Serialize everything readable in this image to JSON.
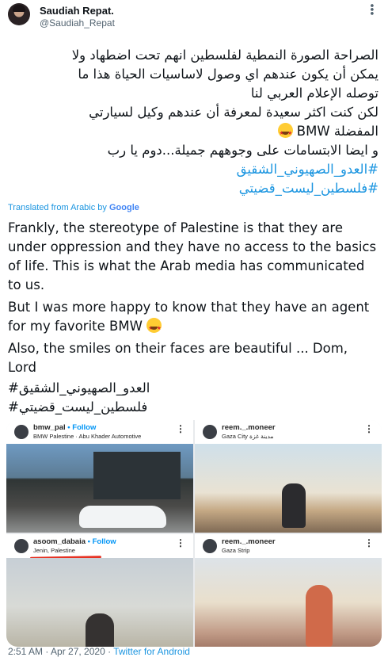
{
  "header": {
    "name": "Saudiah Repat.",
    "handle": "@Saudiah_Repat"
  },
  "tweet": {
    "arabic_lines": [
      "الصراحة الصورة النمطية لفلسطين انهم تحت اضطهاد ولا",
      "يمكن أن يكون عندهم اي وصول لاساسيات الحياة هذا ما",
      "توصله الإعلام العربي لنا",
      "لكن كنت اكثر سعيدة لمعرفة أن عندهم وكيل لسيارتي",
      "المفضلة BMW",
      "و ايضا الابتسامات على وجوههم جميلة...دوم يا رب"
    ],
    "hashtags": [
      "#العدو_الصهيوني_الشقيق",
      "#فلسطين_ليست_قضيتي"
    ],
    "translated_label": "Translated from Arabic by",
    "translated_brand": "Google",
    "english_lines": [
      "Frankly, the stereotype of Palestine is that they are",
      "under oppression and they have no access to the basics",
      "of life. This is what the Arab media has communicated",
      "to us.",
      " But I was more happy to know that they have an agent",
      "for my favorite BMW",
      " Also, the smiles on their faces are beautiful ... Dom,",
      "Lord",
      "#العدو_الصهيوني_الشقيق",
      "#فلسطين_ليست_قضيتي"
    ],
    "emoji": "star-struck-emoji"
  },
  "media": [
    {
      "account": "bmw_pal",
      "follow": "• Follow",
      "subtitle": "BMW Palestine · Abu Khader Automotive"
    },
    {
      "account": "reem._.moneer",
      "follow": "",
      "subtitle": "Gaza City مدينة غزة"
    },
    {
      "account": "asoom_dabaia",
      "follow": "• Follow",
      "subtitle": "Jenin, Palestine"
    },
    {
      "account": "reem._.moneer",
      "follow": "",
      "subtitle": "Gaza Strip"
    }
  ],
  "footer": {
    "timestamp": "2:51 AM · Apr 27, 2020 ·",
    "source": "Twitter for Android"
  }
}
